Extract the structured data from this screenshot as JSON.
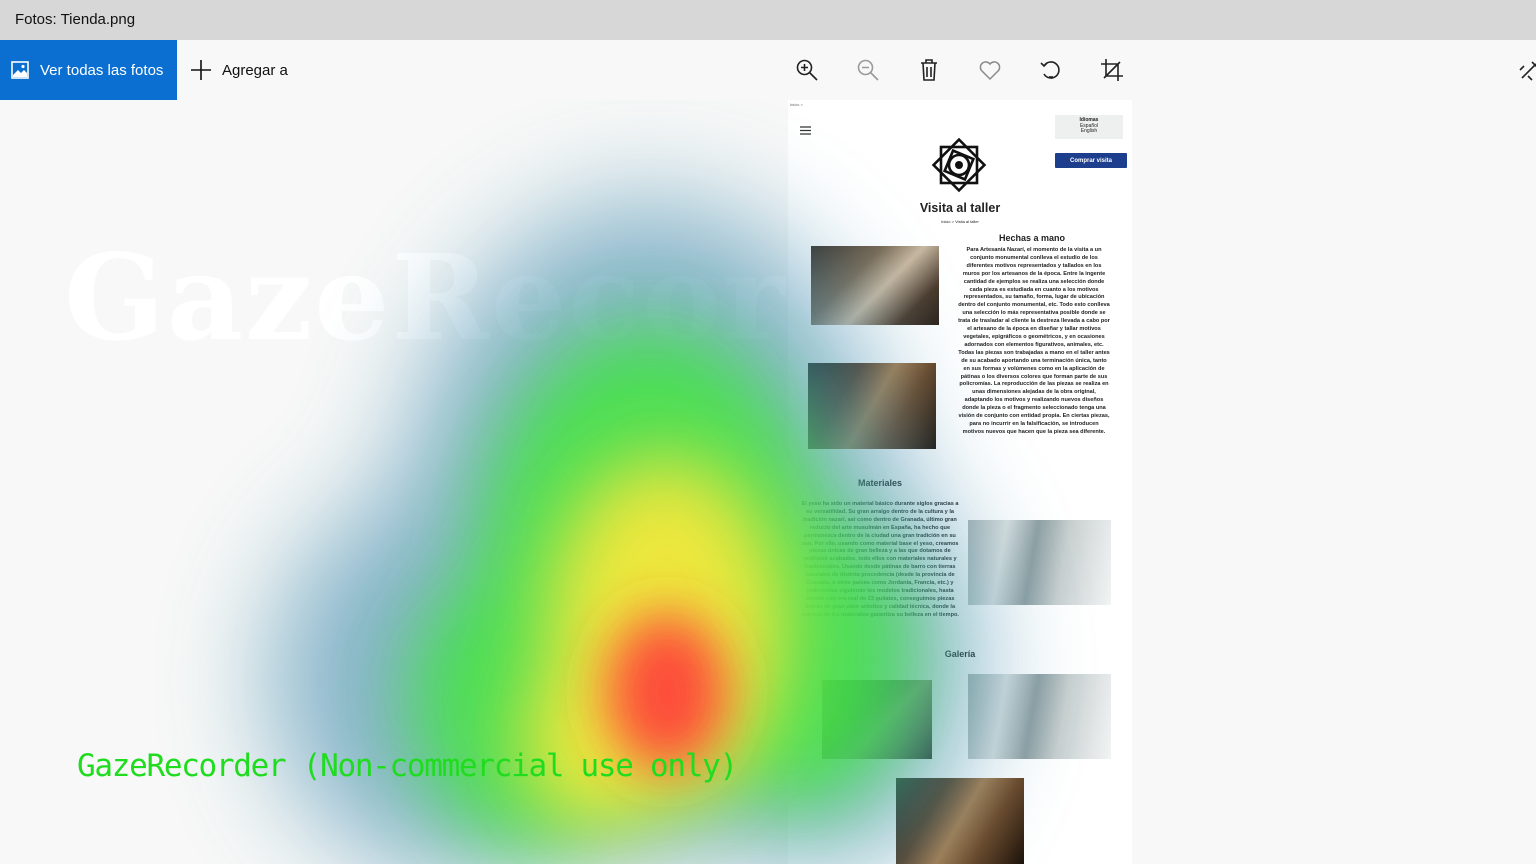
{
  "window": {
    "title": "Fotos: Tienda.png"
  },
  "toolbar": {
    "all_photos_label": "Ver todas las fotos",
    "add_to_label": "Agregar a",
    "tools": [
      "zoom-in-icon",
      "zoom-out-icon",
      "delete-icon",
      "favorite-icon",
      "rotate-icon",
      "crop-icon",
      "edit-icon"
    ]
  },
  "watermarks": {
    "big": "GazeRecorde",
    "bottom": "GazeRecorder (Non-commercial use only)"
  },
  "page_image": {
    "top_crumb": "Inicio >",
    "languages": {
      "heading": "Idiomas",
      "items": [
        "Español",
        "English"
      ]
    },
    "buy_button": "Comprar visita",
    "title": "Visita al taller",
    "breadcrumb": "Inicio > Visita al taller",
    "section_handmade": {
      "heading": "Hechas a mano",
      "text": "Para Artesanía Nazarí, el momento de la visita a un conjunto monumental conlleva el estudio de los diferentes motivos representados y tallados en los muros por los artesanos de la época. Entre la ingente cantidad de ejemplos se realiza una selección donde cada pieza es estudiada en cuanto a los motivos representados, su tamaño, forma, lugar de ubicación dentro del conjunto monumental, etc. Todo esto conlleva una selección lo más representativa posible donde se trata de trasladar al cliente la destreza llevada a cabo por el artesano de la época en diseñar y tallar motivos vegetales, epigráficos o geométricos, y en ocasiones adornados con elementos figurativos, animales, etc. Todas las piezas son trabajadas a mano en el taller antes de su acabado aportando una terminación única, tanto en sus formas y volúmenes como en la aplicación de pátinas o los diversos colores que forman parte de sus policromías. La reproducción de las piezas se realiza en unas dimensiones alejadas de la obra original, adaptando los motivos y realizando nuevos diseños donde la pieza o el fragmento seleccionado tenga una visión de conjunto con entidad propia. En ciertas piezas, para no incurrir en la falsificación, se introducen motivos nuevos que hacen que la pieza sea diferente."
    },
    "section_materials": {
      "heading": "Materiales",
      "text": "El yeso ha sido un material básico durante siglos gracias a su versatilidad. Su gran arraigo dentro de la cultura y la tradición nazarí, así como dentro de Granada, último gran reducto del arte musulmán en España, ha hecho que permanezca dentro de la ciudad una gran tradición en su uso. Por ello, usando como material base el yeso, creamos piezas únicas de gran belleza y a las que dotamos de múltiples acabados, todo ellos con materiales naturales y tradicionales. Usando desde pátinas de barro con tierras naturales de distinta procedencia (desde la provincia de Granada, a otros países como Jordania, Francia, etc.) y policromías siguiendo los modelos tradicionales, hasta dorado con oro real de 23 quilates, conseguimos piezas únicas de gran valor artístico y calidad técnica, donde la nobleza de los materiales garantiza su belleza en el tiempo."
    },
    "section_gallery": {
      "heading": "Galería"
    }
  },
  "heatmap": {
    "colors": [
      "#ff3b3b",
      "#ffe83a",
      "#3fe63f",
      "#4a8fb0"
    ]
  }
}
